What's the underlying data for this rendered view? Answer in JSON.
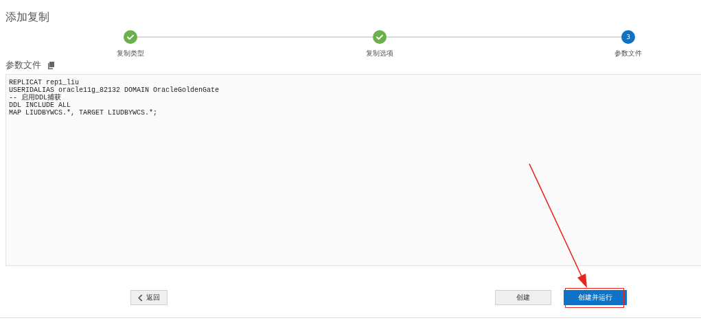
{
  "page": {
    "title": "添加复制"
  },
  "steps": [
    {
      "label": "复制类型",
      "completed": true
    },
    {
      "label": "复制选项",
      "completed": true
    },
    {
      "label": "参数文件",
      "completed": false,
      "number": "3"
    }
  ],
  "section": {
    "title": "参数文件"
  },
  "editor": {
    "lines": [
      "REPLICAT rep1_liu",
      "USERIDALIAS oracle11g_82132 DOMAIN OracleGoldenGate",
      "-- 启用DDL捕获",
      "DDL INCLUDE ALL",
      "MAP LIUDBYWCS.*, TARGET LIUDBYWCS.*;"
    ]
  },
  "buttons": [
    {
      "label": "返回",
      "kind": "back"
    },
    {
      "label": "创建",
      "kind": "secondary"
    },
    {
      "label": "创建并运行",
      "kind": "primary",
      "highlighted": true
    }
  ]
}
